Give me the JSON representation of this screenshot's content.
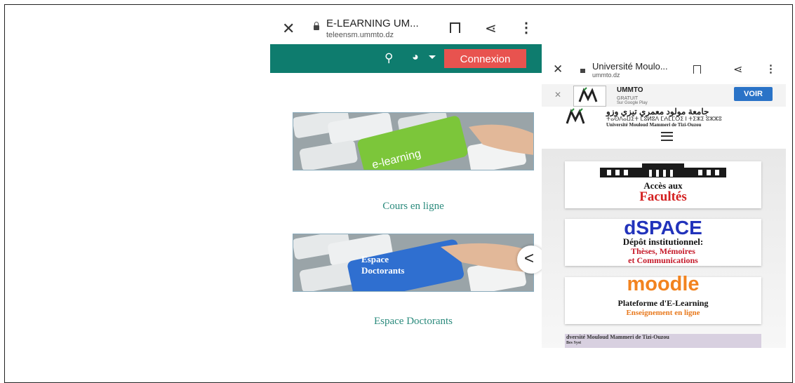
{
  "left_phone": {
    "tab_title": "E-LEARNING UM...",
    "url": "teleensm.ummto.dz",
    "icons": {
      "close": "close-icon",
      "lock": "lock-icon",
      "bookmark": "bookmark-icon",
      "share": "share-icon",
      "menu": "more-vert-icon",
      "search": "search-icon",
      "globe": "globe-icon"
    },
    "login_label": "Connexion",
    "nav_color": "#0e7c6e",
    "login_color": "#e8534f",
    "cards": [
      {
        "image_text": "e-learning",
        "label": "Cours en ligne"
      },
      {
        "image_text_line1": "Espace",
        "image_text_line2": "Doctorants",
        "label": "Espace Doctorants"
      }
    ],
    "back_arrow": "<"
  },
  "right_phone": {
    "tab_title": "Université Moulo...",
    "url": "ummto.dz",
    "app_banner": {
      "name": "UMMTO",
      "price": "GRATUIT",
      "store": "Sur Google Play",
      "cta": "VOIR"
    },
    "header": {
      "arabic": "جامعة مولود معمري تيزي وزو",
      "tifinagh": "ⵜⴰⵙⴷⴰⵡⵉⵜ ⵎⵓⵍⵓⴷ ⵎⵄⵎⵎⵔⵉ ⵏ ⵜⵉⵣⵉ ⵓⵣⵣⵓ",
      "french": "Université Mouloud Mammeri de Tizi-Ouzou"
    },
    "banners": [
      {
        "line1": "Accès aux",
        "line2": "Facultés"
      },
      {
        "title": "dSPACE",
        "line1": "Dépôt institutionnel:",
        "line2": "Thèses, Mémoires",
        "line3": "et Communications"
      },
      {
        "title": "moodle",
        "line1": "Plateforme d'E-Learning",
        "line2": "Enseignement en ligne"
      }
    ],
    "partial_banner": {
      "line1": "dversité Mouloud Mammeri de Tizi-Ouzou",
      "line2": "Bes Syst"
    }
  }
}
